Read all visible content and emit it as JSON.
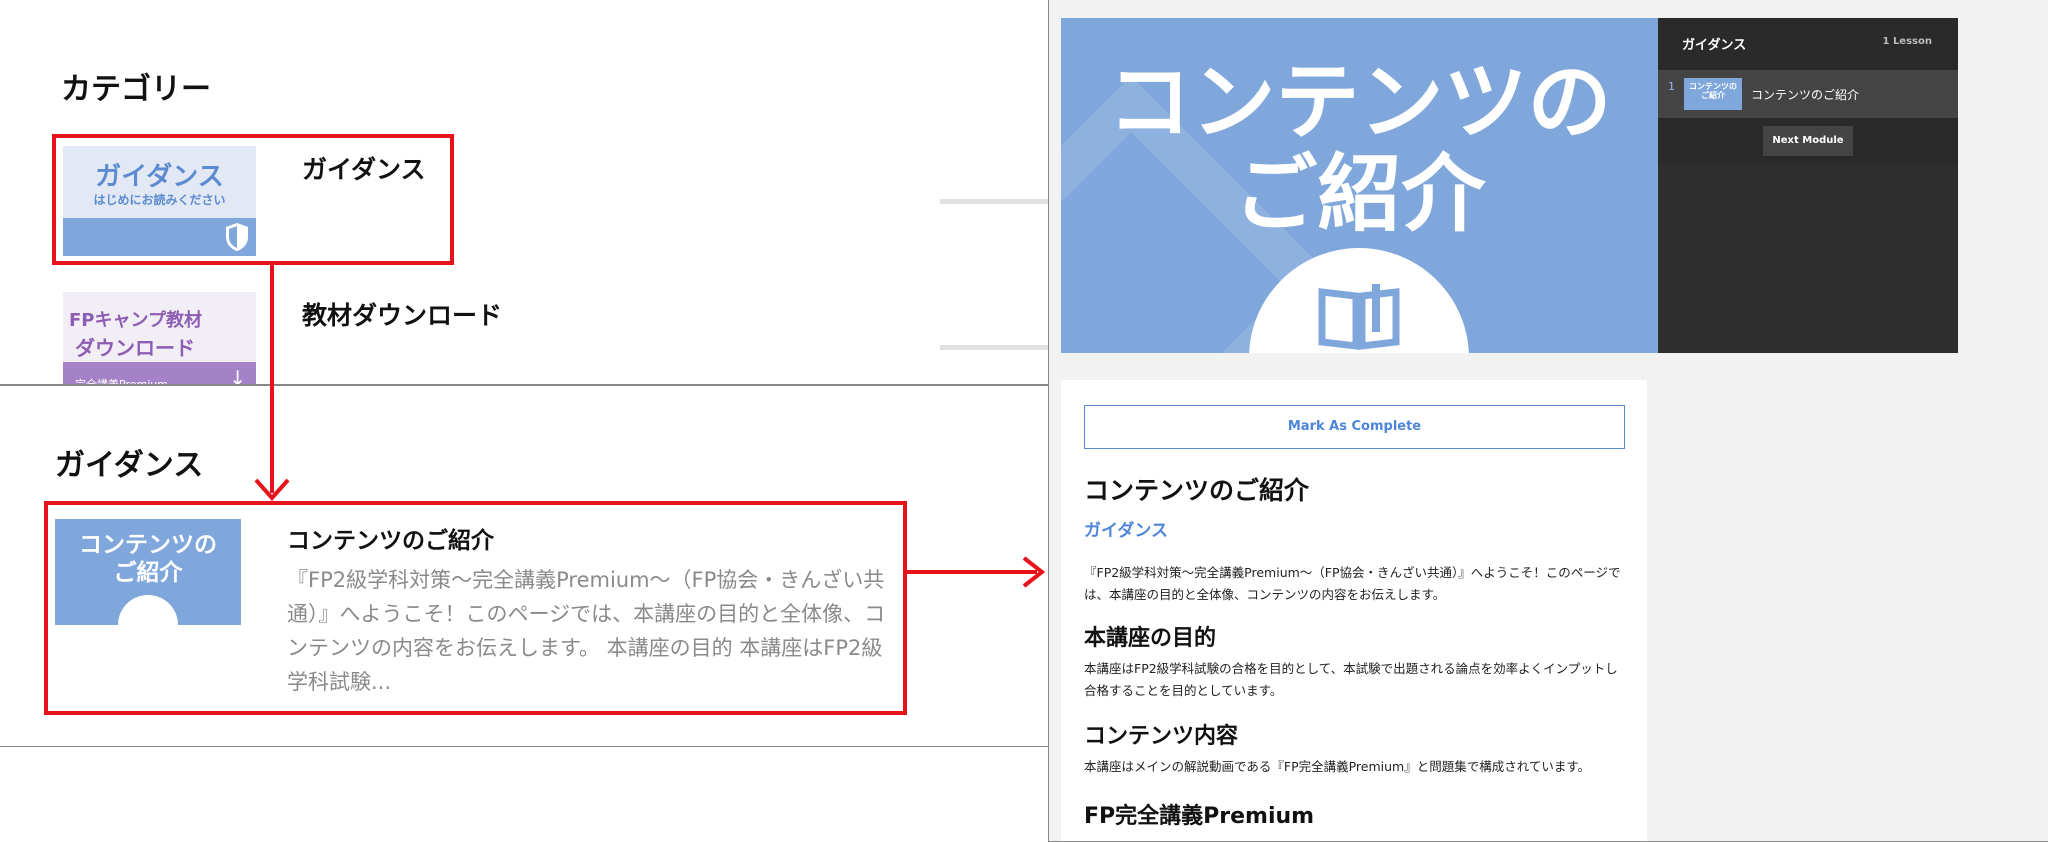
{
  "category_panel": {
    "title": "カテゴリー",
    "items": [
      {
        "name": "ガイダンス",
        "thumb_title": "ガイダンス",
        "thumb_subtitle": "はじめにお読みください"
      },
      {
        "name": "教材ダウンロード",
        "thumb_line1": "FPキャンプ教材",
        "thumb_line2": "ダウンロード",
        "thumb_line3": "完全講義Premium"
      }
    ]
  },
  "module_panel": {
    "title": "ガイダンス",
    "lesson": {
      "thumb_text": "コンテンツの\nご紹介",
      "title": "コンテンツのご紹介",
      "description": "『FP2級学科対策〜完全講義Premium〜（FP協会・きんざい共通）』へようこそ！このページでは、本講座の目的と全体像、コンテンツの内容をお伝えします。 本講座の目的 本講座はFP2級学科試験..."
    }
  },
  "lesson_page": {
    "hero_text": "コンテンツの\nご紹介",
    "sidebar": {
      "module_title": "ガイダンス",
      "lesson_count": "1 Lesson",
      "items": [
        {
          "number": "1",
          "thumb_text": "コンテンツの\nご紹介",
          "label": "コンテンツのご紹介"
        }
      ],
      "next_button": "Next Module"
    },
    "mark_complete": "Mark As Complete",
    "heading": "コンテンツのご紹介",
    "category_link": "ガイダンス",
    "intro": "『FP2級学科対策〜完全講義Premium〜（FP協会・きんざい共通）』へようこそ！このページでは、本講座の目的と全体像、コンテンツの内容をお伝えします。",
    "sections": [
      {
        "heading": "本講座の目的",
        "body": "本講座はFP2級学科試験の合格を目的として、本試験で出題される論点を効率よくインプットし合格することを目的としています。"
      },
      {
        "heading": "コンテンツ内容",
        "body": "本講座はメインの解説動画である『FP完全講義Premium』と問題集で構成されています。"
      },
      {
        "heading": "FP完全講義Premium",
        "body": ""
      }
    ]
  },
  "colors": {
    "accent_blue": "#80a7dc",
    "link_blue": "#4d86d8",
    "highlight_red": "#e8131a",
    "sidebar_dark": "#2a2a2a"
  },
  "icons": [
    "shield-icon",
    "download-arrow-icon",
    "open-book-icon"
  ]
}
